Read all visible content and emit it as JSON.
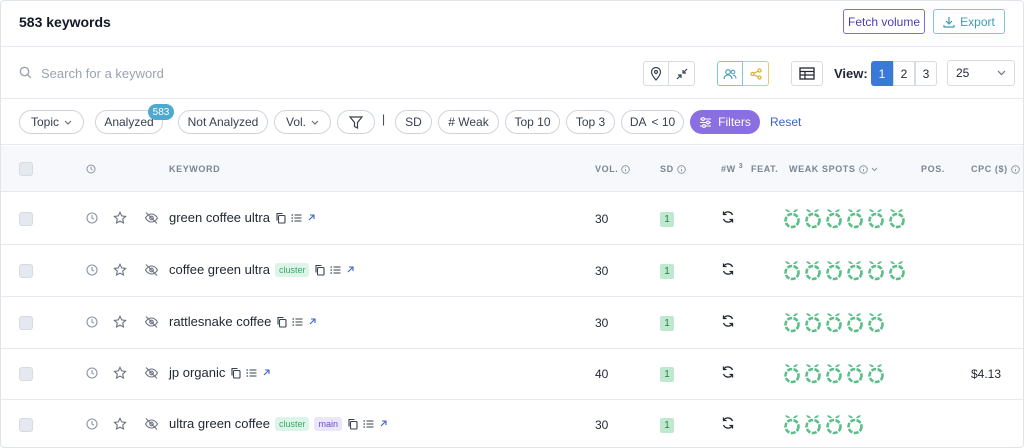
{
  "header": {
    "title": "583 keywords",
    "fetch_label": "Fetch volume",
    "export_label": "Export"
  },
  "search": {
    "placeholder": "Search for a keyword",
    "value": "",
    "view_label": "View:",
    "pages": [
      "1",
      "2",
      "3"
    ],
    "active_page": "1",
    "per_page": "25"
  },
  "filters": {
    "topic": "Topic",
    "analyzed": "Analyzed",
    "analyzed_count": "583",
    "not_analyzed": "Not Analyzed",
    "vol": "Vol.",
    "divider": "|",
    "sd": "SD",
    "weak": "# Weak",
    "top10": "Top 10",
    "top3": "Top 3",
    "da": "DA",
    "da_value": "< 10",
    "filters_label": "Filters",
    "reset_label": "Reset"
  },
  "table": {
    "columns": {
      "keyword": "KEYWORD",
      "vol": "VOL.",
      "sd": "SD",
      "w": "#W",
      "w_sup": "3",
      "feat": "FEAT.",
      "weak_spots": "WEAK SPOTS",
      "pos": "POS.",
      "cpc": "CPC ($)"
    },
    "rows": [
      {
        "keyword": "green coffee ultra",
        "tags": [],
        "vol": "30",
        "sd": "1",
        "weak_spots": 6,
        "cpc": ""
      },
      {
        "keyword": "coffee green ultra",
        "tags": [
          "cluster"
        ],
        "vol": "30",
        "sd": "1",
        "weak_spots": 6,
        "cpc": ""
      },
      {
        "keyword": "rattlesnake coffee",
        "tags": [],
        "vol": "30",
        "sd": "1",
        "weak_spots": 5,
        "cpc": ""
      },
      {
        "keyword": "jp organic",
        "tags": [],
        "vol": "40",
        "sd": "1",
        "weak_spots": 5,
        "cpc": "$4.13"
      },
      {
        "keyword": "ultra green coffee",
        "tags": [
          "cluster",
          "main"
        ],
        "vol": "30",
        "sd": "1",
        "weak_spots": 4,
        "cpc": ""
      }
    ]
  },
  "colors": {
    "accent_purple": "#8a6fe0",
    "accent_blue": "#3a79d8",
    "spot_green": "#5cbf8a"
  }
}
